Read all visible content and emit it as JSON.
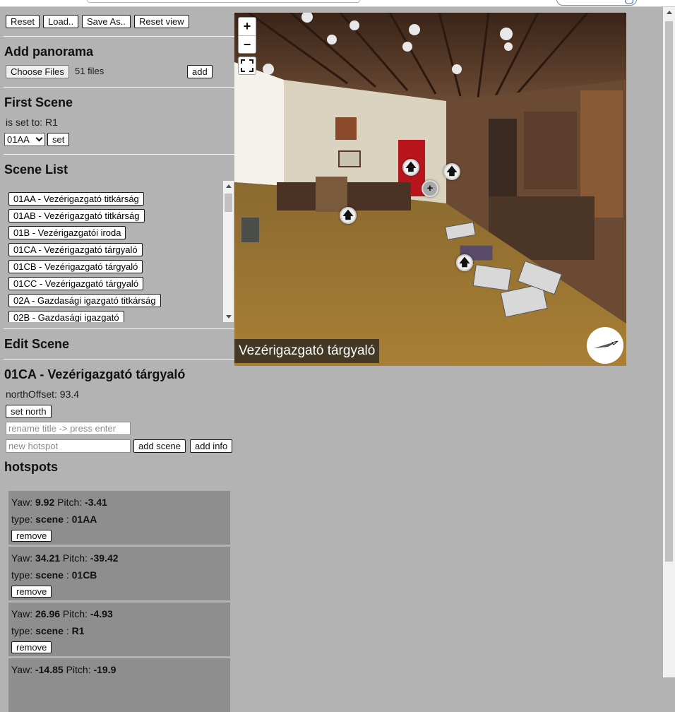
{
  "toolbar": {
    "reset_label": "Reset",
    "load_label": "Load..",
    "save_as_label": "Save As..",
    "reset_view_label": "Reset view"
  },
  "add_panorama": {
    "heading": "Add panorama",
    "choose_files_label": "Choose Files",
    "files_count": "51 files",
    "add_label": "add"
  },
  "first_scene": {
    "heading": "First Scene",
    "status": "is set to: R1",
    "selected_option": "01AA",
    "set_label": "set"
  },
  "scene_list": {
    "heading": "Scene List",
    "items": [
      "01AA - Vezérigazgató titkárság",
      "01AB - Vezérigazgató titkárság",
      "01B - Vezérigazgatói iroda",
      "01CA - Vezérigazgató tárgyaló",
      "01CB - Vezérigazgató tárgyaló",
      "01CC - Vezérigazgató tárgyaló",
      "02A - Gazdasági igazgató titkárság",
      "02B - Gazdasági igazgató"
    ]
  },
  "edit_scene": {
    "heading": "Edit Scene",
    "scene_title": "01CA - Vezérigazgató tárgyaló",
    "north_offset": "northOffset: 93.4",
    "set_north_label": "set north",
    "rename_placeholder": "rename title -> press enter",
    "hotspot_placeholder": "new hotspot",
    "add_scene_label": "add scene",
    "add_info_label": "add info"
  },
  "hotspots": {
    "heading": "hotspots",
    "yaw_label": "Yaw:",
    "pitch_label": "Pitch:",
    "type_label": "type:",
    "remove_label": "remove",
    "items": [
      {
        "yaw": "9.92",
        "pitch": "-3.41",
        "type": "scene",
        "target": "01AA"
      },
      {
        "yaw": "34.21",
        "pitch": "-39.42",
        "type": "scene",
        "target": "01CB"
      },
      {
        "yaw": "26.96",
        "pitch": "-4.93",
        "type": "scene",
        "target": "R1"
      },
      {
        "yaw": "-14.85",
        "pitch": "-19.9",
        "type": "",
        "target": ""
      }
    ]
  },
  "viewer": {
    "title": "Vezérigazgató tárgyaló",
    "zoom_in": "+",
    "zoom_out": "−",
    "hotspot_arrow_glyph": "🡅",
    "hotspot_info_glyph": "+"
  }
}
